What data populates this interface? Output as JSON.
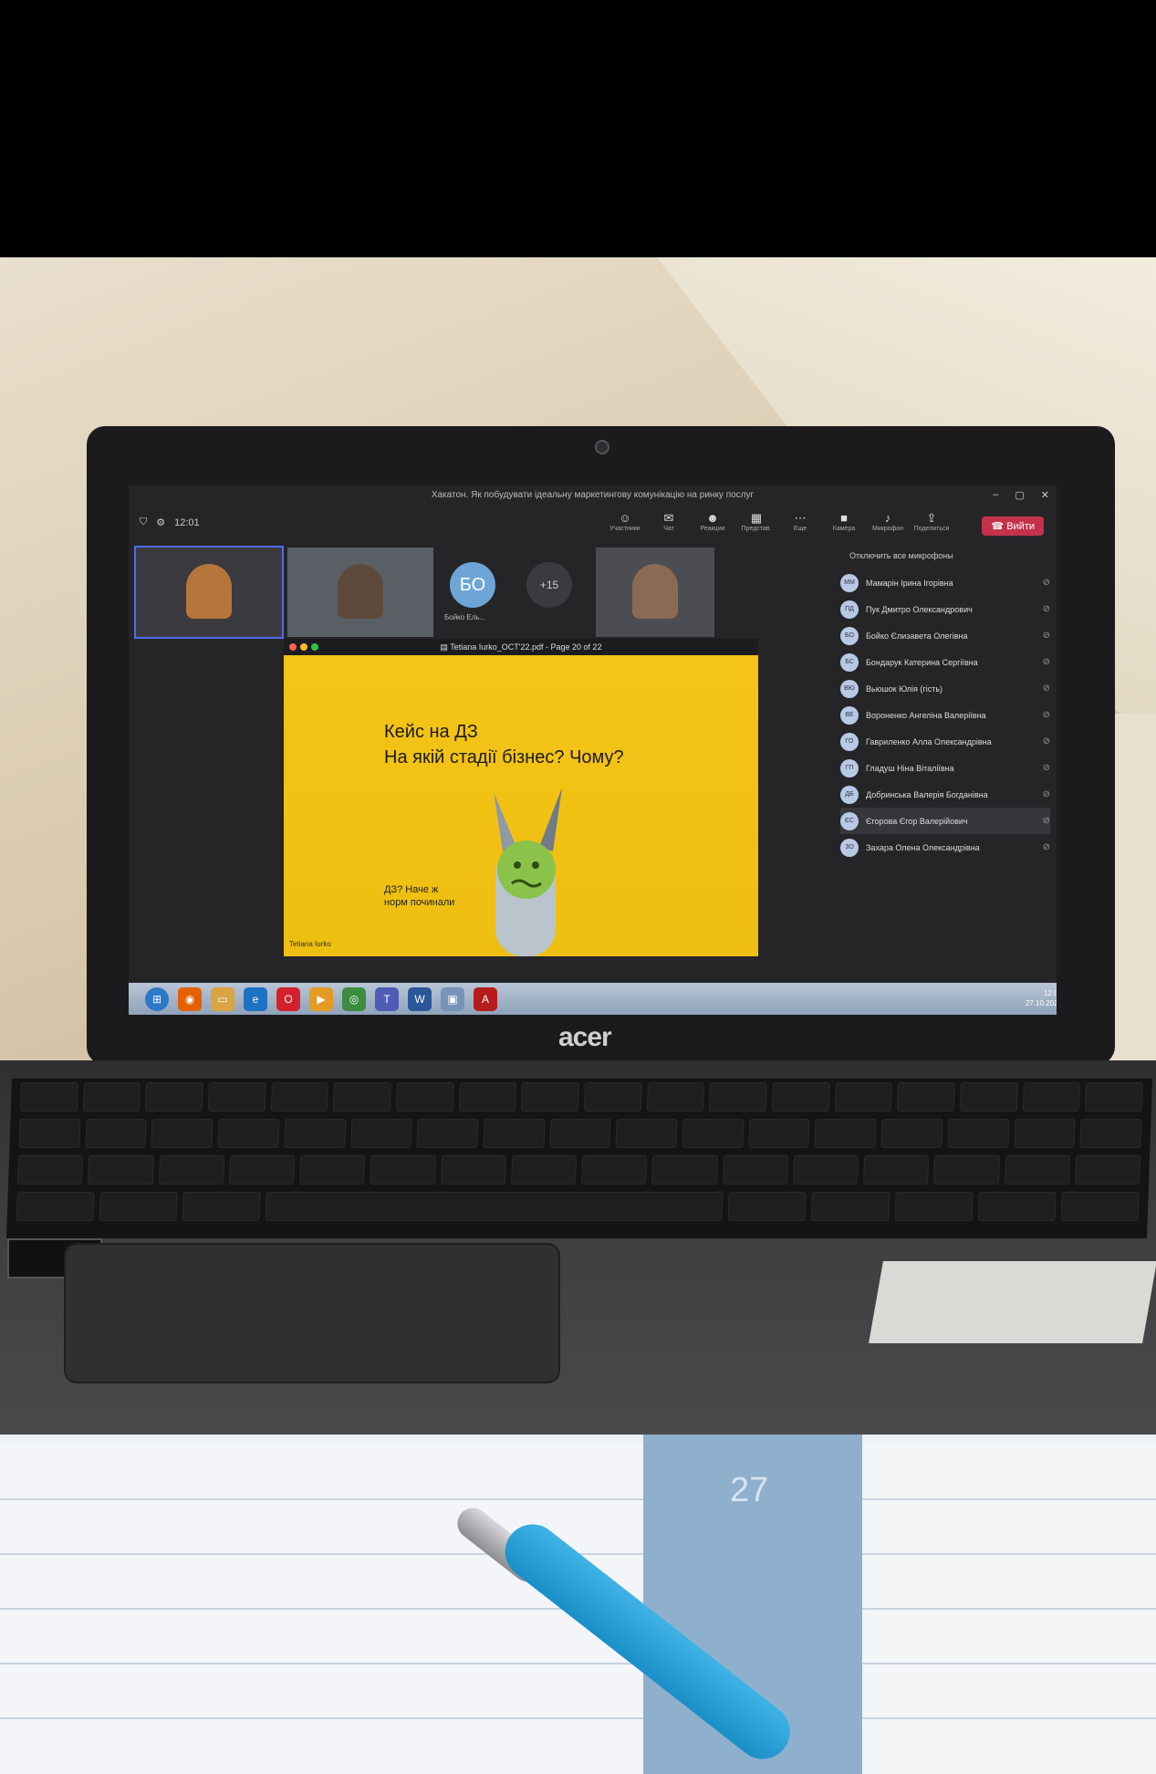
{
  "window": {
    "title": "Хакатон. Як побудувати ідеальну маркетингову комунікацію на ринку послуг",
    "timer": "12:01",
    "leave_label": "Вийти"
  },
  "toolbar": {
    "buttons": [
      "Участники",
      "Чат",
      "Реакции",
      "Представ.",
      "Еще",
      "Камера",
      "Микрофон",
      "Поделиться"
    ]
  },
  "tiles": {
    "avatar_initials": "БО",
    "avatar_name": "Бойко Ель...",
    "more_count": "+15"
  },
  "share": {
    "file_label": "Tetiana Iurko_OCT'22.pdf - Page 20 of 22"
  },
  "slide": {
    "title_line1": "Кейс на ДЗ",
    "title_line2": "На якій стадії бізнес? Чому?",
    "note": "ДЗ? Наче ж норм починали",
    "author": "Tetiana Iurko"
  },
  "participants": {
    "mute_all_label": "Отключить все микрофоны",
    "list": [
      {
        "initials": "ММ",
        "name": "Мамарін Ірина Ігорівна"
      },
      {
        "initials": "ПД",
        "name": "Пук Дмитро Олександрович"
      },
      {
        "initials": "БО",
        "name": "Бойко Єлизавета Олегівна"
      },
      {
        "initials": "БС",
        "name": "Бондарук Катерина Сергіївна"
      },
      {
        "initials": "ВЮ",
        "name": "Вьюшок Юлія (гість)"
      },
      {
        "initials": "ВЕ",
        "name": "Вороненко Ангеліна Валеріївна"
      },
      {
        "initials": "ГО",
        "name": "Гавриленко Алла Олександрівна"
      },
      {
        "initials": "ГП",
        "name": "Гладуш Ніна Віталіївна"
      },
      {
        "initials": "ДБ",
        "name": "Добринська Валерія Богданівна"
      },
      {
        "initials": "ЄС",
        "name": "Єгорова Єгор Валерійович"
      },
      {
        "initials": "ЗО",
        "name": "Захара Олена Олександрівна"
      }
    ]
  },
  "taskbar": {
    "clock_time": "12:01",
    "clock_date": "27.10.2023"
  },
  "laptop": {
    "brand": "acer"
  },
  "notebook": {
    "date_number": "27"
  },
  "colors": {
    "slide_yellow": "#f4c418",
    "leave_red": "#c4314b",
    "teams_accent": "#4f6bed",
    "pen_blue": "#1a8fc7"
  }
}
